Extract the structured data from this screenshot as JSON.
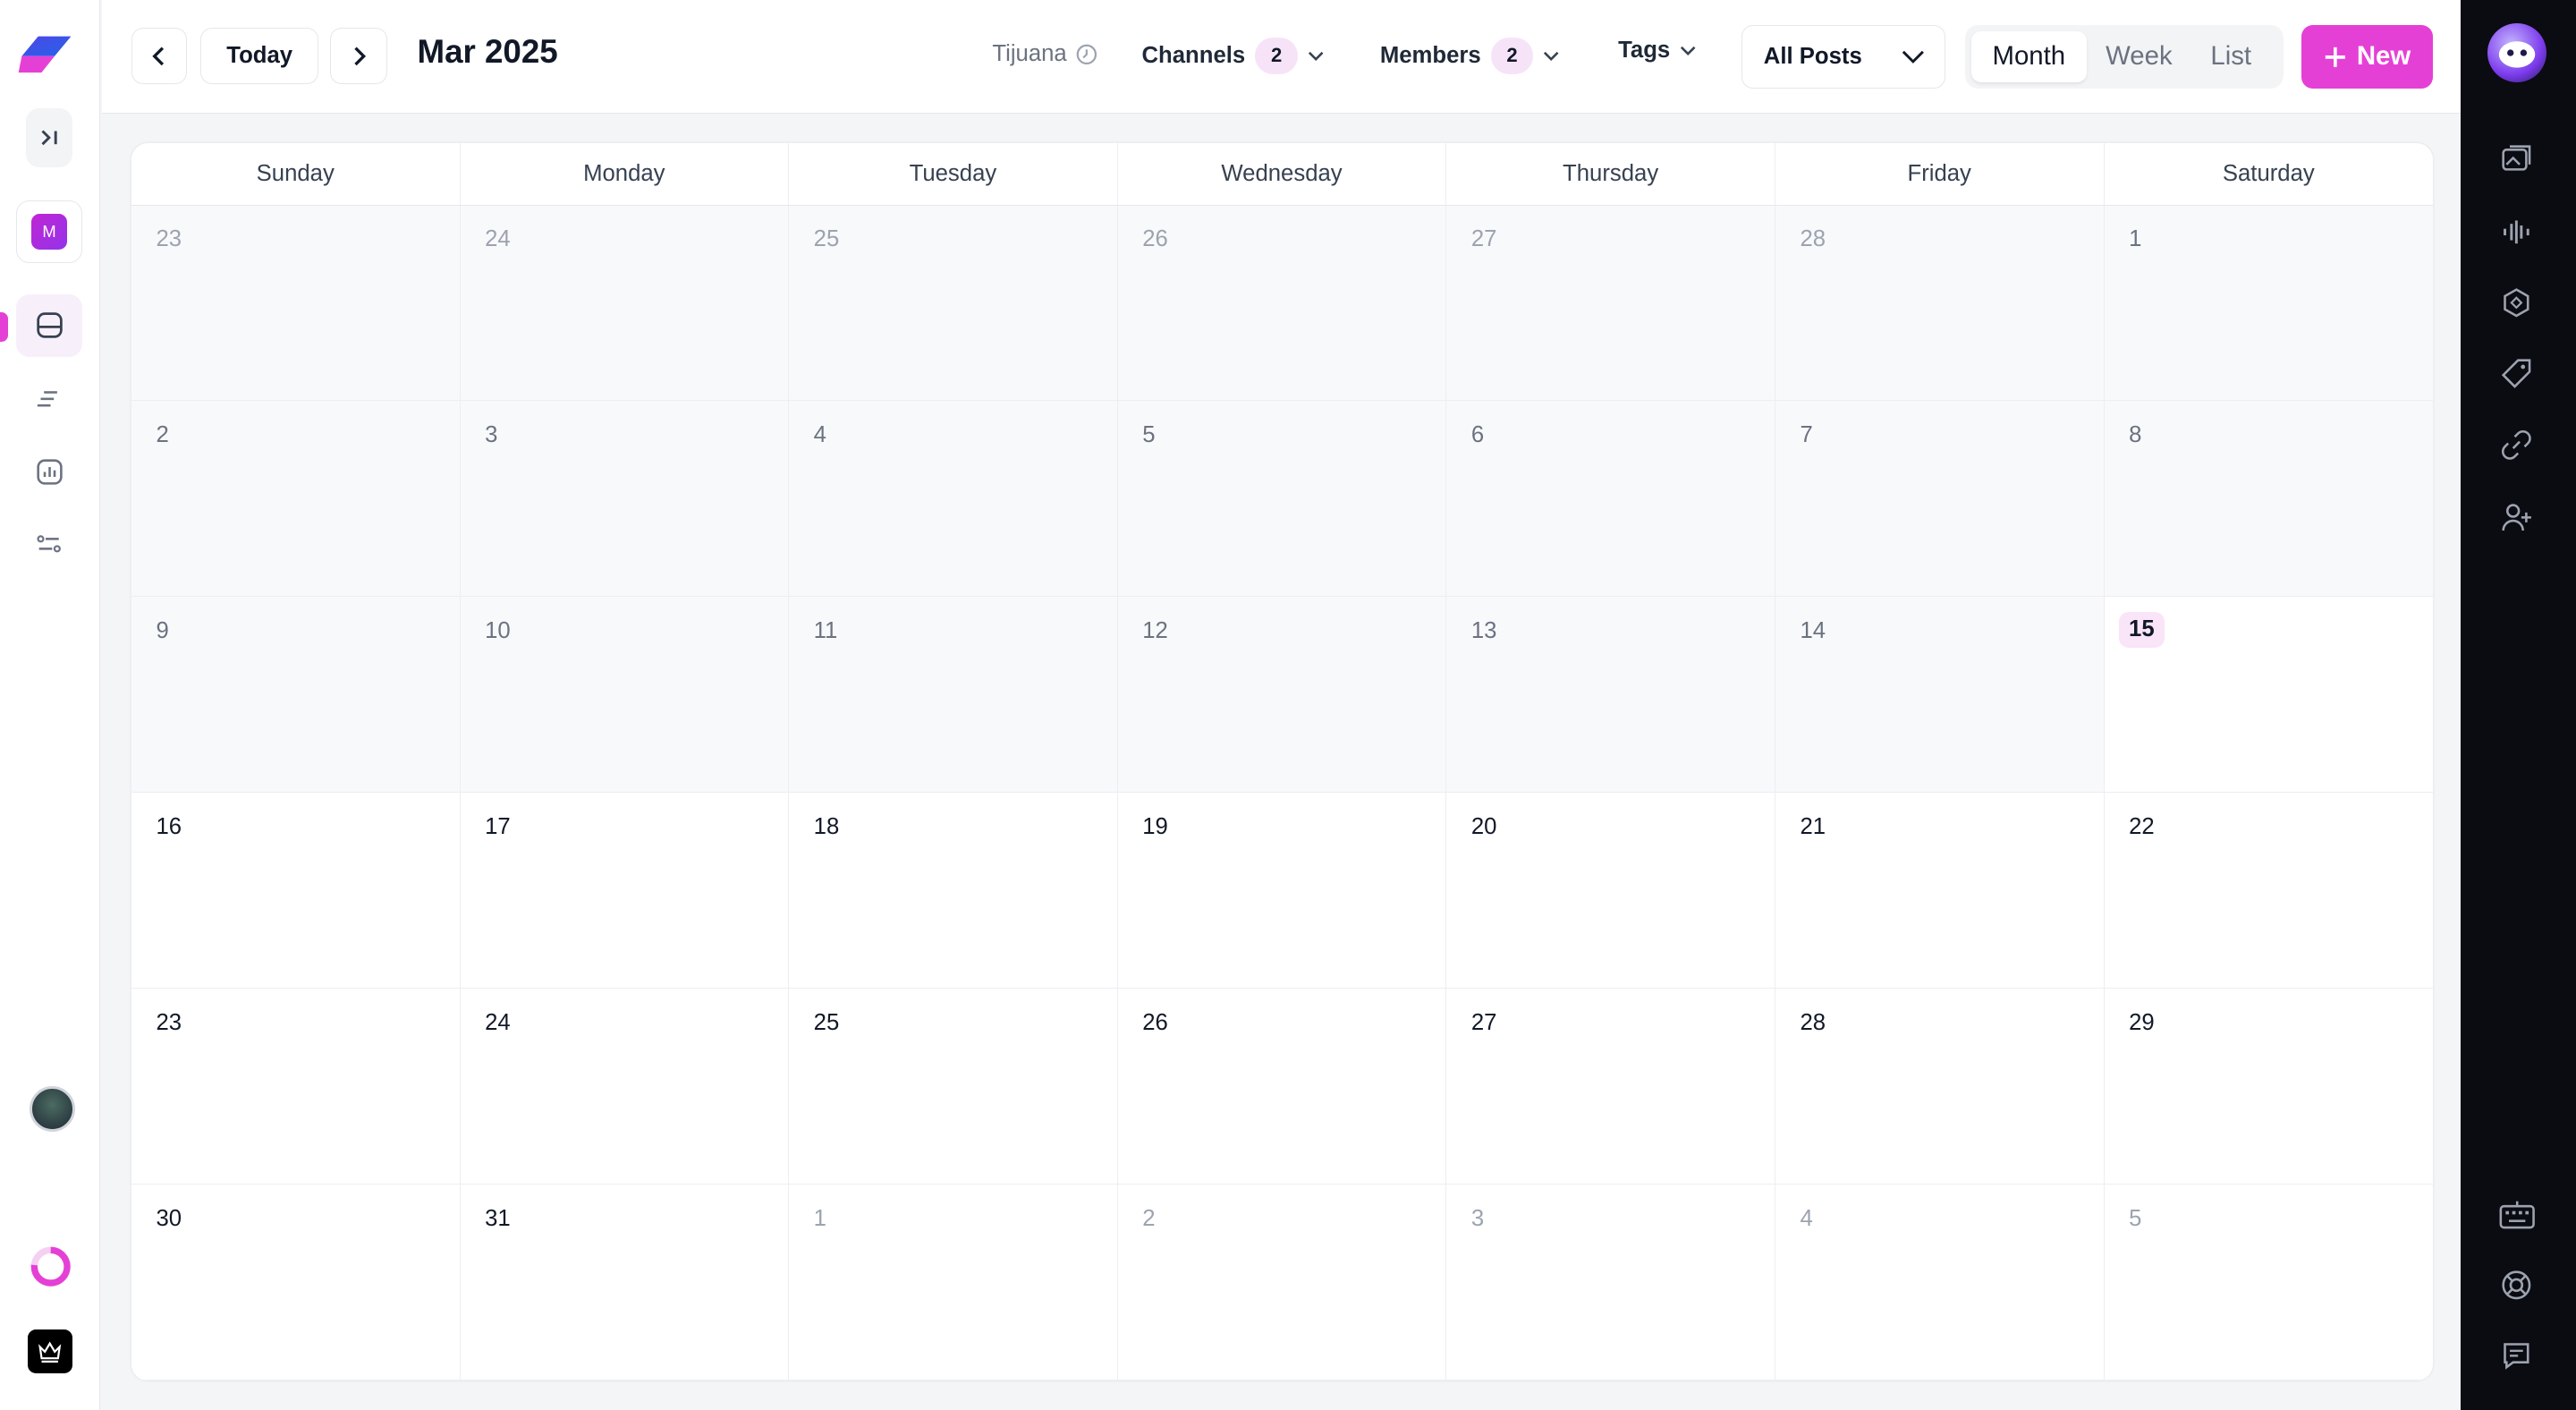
{
  "app": {
    "workspace_initial": "M",
    "accent_color": "#e540d6"
  },
  "toolbar": {
    "today_label": "Today",
    "month_title": "Mar 2025",
    "timezone": "Tijuana",
    "channels_label": "Channels",
    "channels_count": "2",
    "members_label": "Members",
    "members_count": "2",
    "tags_label": "Tags",
    "posts_select_value": "All Posts",
    "views": [
      "Month",
      "Week",
      "List"
    ],
    "active_view": "Month",
    "new_label": "New"
  },
  "calendar": {
    "weekdays": [
      "Sunday",
      "Monday",
      "Tuesday",
      "Wednesday",
      "Thursday",
      "Friday",
      "Saturday"
    ],
    "today": "15",
    "weeks": [
      [
        {
          "day": "23",
          "state": "other"
        },
        {
          "day": "24",
          "state": "other"
        },
        {
          "day": "25",
          "state": "other"
        },
        {
          "day": "26",
          "state": "other"
        },
        {
          "day": "27",
          "state": "other"
        },
        {
          "day": "28",
          "state": "other"
        },
        {
          "day": "1",
          "state": "past"
        }
      ],
      [
        {
          "day": "2",
          "state": "past"
        },
        {
          "day": "3",
          "state": "past"
        },
        {
          "day": "4",
          "state": "past"
        },
        {
          "day": "5",
          "state": "past"
        },
        {
          "day": "6",
          "state": "past"
        },
        {
          "day": "7",
          "state": "past"
        },
        {
          "day": "8",
          "state": "past"
        }
      ],
      [
        {
          "day": "9",
          "state": "past"
        },
        {
          "day": "10",
          "state": "past"
        },
        {
          "day": "11",
          "state": "past"
        },
        {
          "day": "12",
          "state": "past"
        },
        {
          "day": "13",
          "state": "past"
        },
        {
          "day": "14",
          "state": "past"
        },
        {
          "day": "15",
          "state": "today"
        }
      ],
      [
        {
          "day": "16",
          "state": "current"
        },
        {
          "day": "17",
          "state": "current"
        },
        {
          "day": "18",
          "state": "current"
        },
        {
          "day": "19",
          "state": "current"
        },
        {
          "day": "20",
          "state": "current"
        },
        {
          "day": "21",
          "state": "current"
        },
        {
          "day": "22",
          "state": "current"
        }
      ],
      [
        {
          "day": "23",
          "state": "current"
        },
        {
          "day": "24",
          "state": "current"
        },
        {
          "day": "25",
          "state": "current"
        },
        {
          "day": "26",
          "state": "current"
        },
        {
          "day": "27",
          "state": "current"
        },
        {
          "day": "28",
          "state": "current"
        },
        {
          "day": "29",
          "state": "current"
        }
      ],
      [
        {
          "day": "30",
          "state": "current"
        },
        {
          "day": "31",
          "state": "current"
        },
        {
          "day": "1",
          "state": "other-next"
        },
        {
          "day": "2",
          "state": "other-next"
        },
        {
          "day": "3",
          "state": "other-next"
        },
        {
          "day": "4",
          "state": "other-next"
        },
        {
          "day": "5",
          "state": "other-next"
        }
      ]
    ]
  },
  "left_nav": [
    "collapse-icon",
    "calendar-icon",
    "posts-icon",
    "analytics-icon",
    "settings-icon"
  ],
  "right_rail": [
    "media-icon",
    "audio-icon",
    "badge-icon",
    "tag-icon",
    "link-icon",
    "add-user-icon",
    "keyboard-icon",
    "help-icon",
    "chat-icon"
  ]
}
